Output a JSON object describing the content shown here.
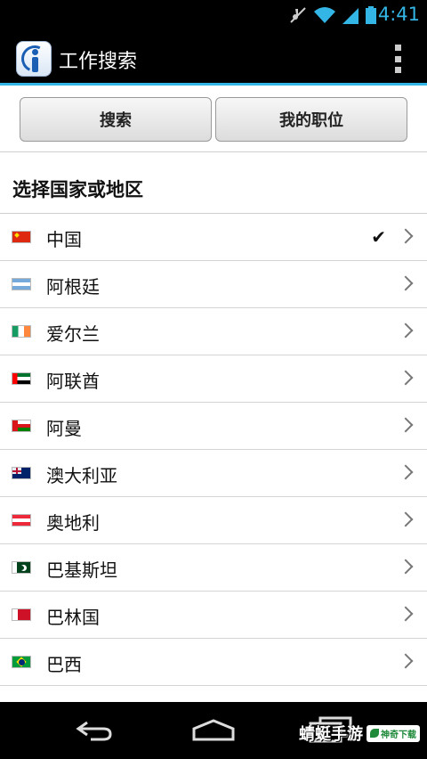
{
  "status_bar": {
    "time": "4:41",
    "icons": [
      "mute-icon",
      "wifi-icon",
      "signal-icon",
      "battery-icon"
    ]
  },
  "action_bar": {
    "title": "工作搜索",
    "logo": "indeed-logo-icon",
    "menu": "overflow-menu-icon",
    "accent": "#33b5e5"
  },
  "tabs": {
    "search_label": "搜索",
    "my_jobs_label": "我的职位"
  },
  "section": {
    "title": "选择国家或地区"
  },
  "countries": [
    {
      "name": "中国",
      "flag": "flag-china",
      "selected": true
    },
    {
      "name": "阿根廷",
      "flag": "flag-argentina",
      "selected": false
    },
    {
      "name": "爱尔兰",
      "flag": "flag-ireland",
      "selected": false
    },
    {
      "name": "阿联酋",
      "flag": "flag-uae",
      "selected": false
    },
    {
      "name": "阿曼",
      "flag": "flag-oman",
      "selected": false
    },
    {
      "name": "澳大利亚",
      "flag": "flag-australia",
      "selected": false
    },
    {
      "name": "奥地利",
      "flag": "flag-austria",
      "selected": false
    },
    {
      "name": "巴基斯坦",
      "flag": "flag-pakistan",
      "selected": false
    },
    {
      "name": "巴林国",
      "flag": "flag-bahrain",
      "selected": false
    },
    {
      "name": "巴西",
      "flag": "flag-brazil",
      "selected": false
    }
  ],
  "check_mark": "✔",
  "nav_bar": {
    "back": "back-icon",
    "home": "home-icon",
    "recent": "recent-apps-icon"
  },
  "watermark": {
    "main": "蜻蜓手游",
    "badge": "神奇下载"
  }
}
